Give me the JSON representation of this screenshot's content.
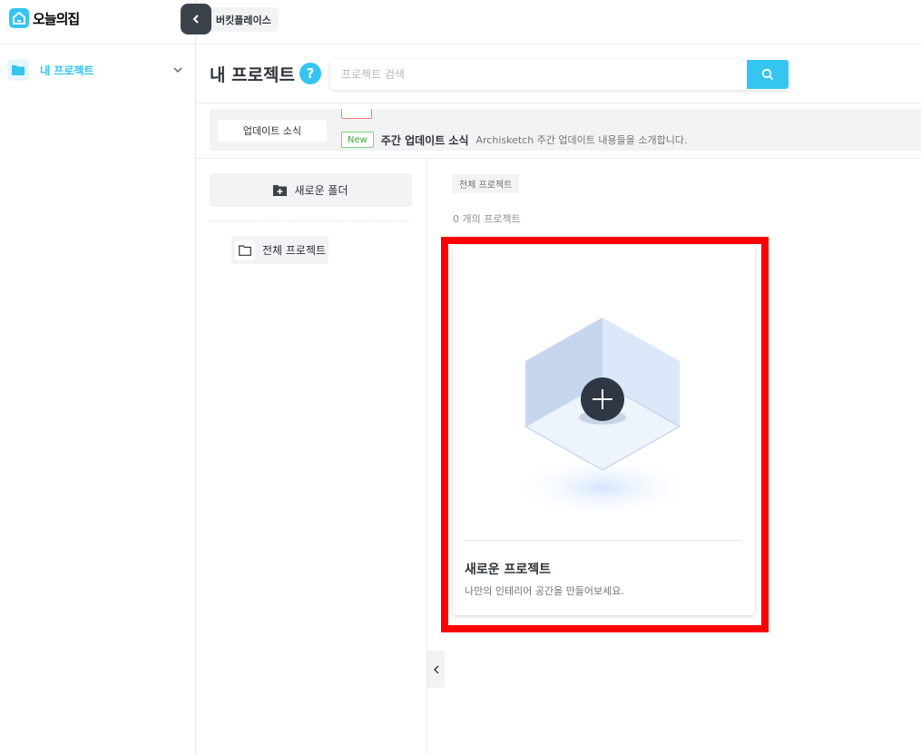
{
  "app": {
    "logo_text": "오늘의집"
  },
  "breadcrumb": {
    "label": "버킷플레이스"
  },
  "sidebar": {
    "items": [
      {
        "label": "내 프로젝트"
      }
    ]
  },
  "header": {
    "title": "내 프로젝트",
    "help_symbol": "?",
    "search": {
      "placeholder": "프로젝트 검색",
      "value": ""
    }
  },
  "updates": {
    "button_label": "업데이트 소식",
    "latest": {
      "badge": "New",
      "title": "주간 업데이트 소식",
      "description": "Archisketch 주간 업데이트 내용들을 소개합니다."
    }
  },
  "folders": {
    "new_folder_label": "새로운 폴더",
    "items": [
      {
        "label": "전체 프로젝트"
      }
    ]
  },
  "main": {
    "filter_tag": "전체 프로젝트",
    "count_text": "0 개의 프로젝트",
    "new_project_card": {
      "title": "새로운 프로젝트",
      "description": "나만의 인테리어 공간을 만들어보세요."
    }
  },
  "colors": {
    "accent": "#35c5f0",
    "highlight": "#ff0000",
    "dark_button": "#3c4249"
  }
}
